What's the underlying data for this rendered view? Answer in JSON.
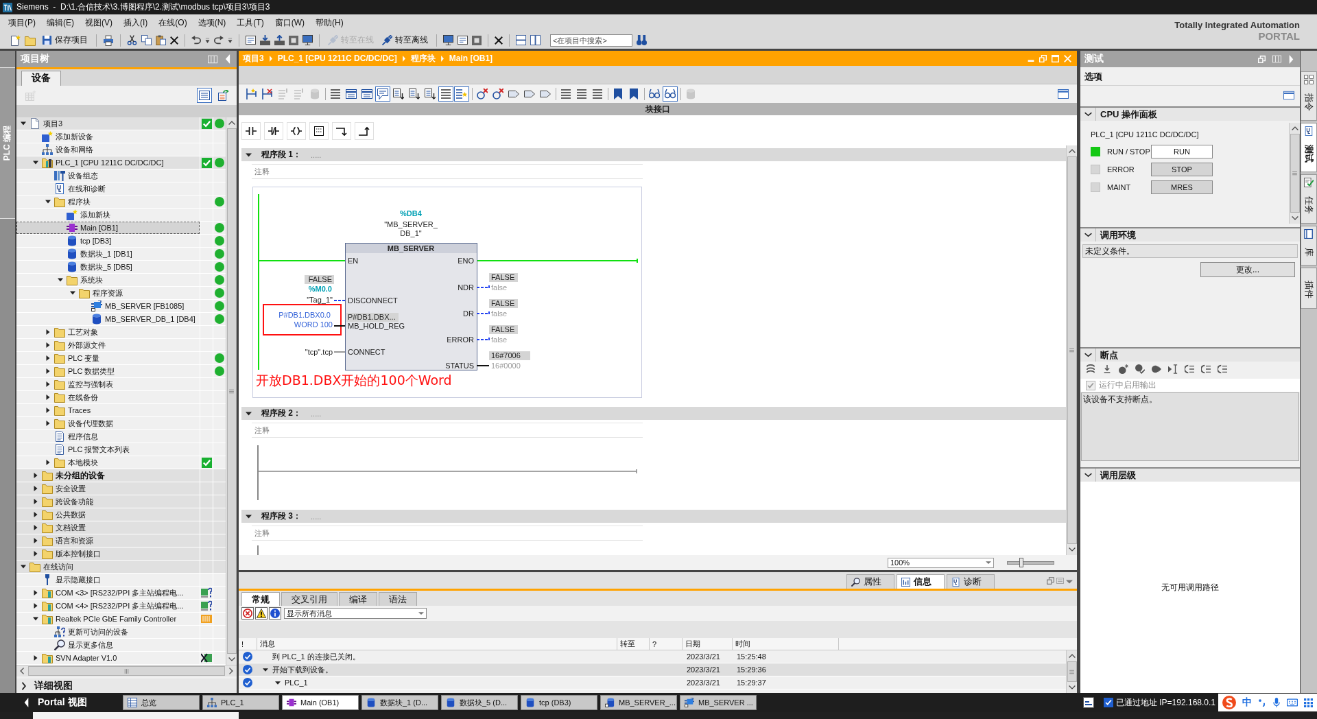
{
  "window": {
    "title": "Siemens  -  D:\\1.合信技术\\3.博图程序\\2.测试\\modbus tcp\\项目3\\项目3"
  },
  "menu": [
    "项目(P)",
    "编辑(E)",
    "视图(V)",
    "插入(I)",
    "在线(O)",
    "选项(N)",
    "工具(T)",
    "窗口(W)",
    "帮助(H)"
  ],
  "branding": {
    "line_1": "Totally Integrated Automation",
    "line_2": "PORTAL"
  },
  "toolbar": {
    "save": {
      "label": "保存项目"
    },
    "go_online": {
      "label": "转至在线",
      "disabled": true
    },
    "go_offline": {
      "label": "转至离线",
      "disabled": false
    },
    "search": {
      "placeholder": "<在项目中搜索>"
    }
  },
  "left_tabs": [
    {
      "label": "PLC 编程",
      "selected": true
    }
  ],
  "project_tree": {
    "title": "项目树",
    "tabs": [
      {
        "label": "设备",
        "selected": true
      }
    ],
    "toolbar": [
      {
        "disabled": true,
        "pressed": false
      },
      {
        "disabled": false,
        "pressed": true
      },
      {
        "disabled": false,
        "pressed": false
      }
    ],
    "items": [
      {
        "label": "项目3",
        "kind": "project",
        "expanded": true,
        "selected": false,
        "check": true,
        "dot": true,
        "children": [
          {
            "label": "添加新设备",
            "kind": "add",
            "selected": false,
            "check": false,
            "dot": false
          },
          {
            "label": "设备和网络",
            "kind": "network",
            "selected": false,
            "check": false,
            "dot": false
          },
          {
            "label": "PLC_1 [CPU 1211C DC/DC/DC]",
            "kind": "plc",
            "expanded": true,
            "selected": false,
            "check": true,
            "dot": true,
            "children": [
              {
                "label": "设备组态",
                "kind": "config",
                "selected": false,
                "check": false,
                "dot": false
              },
              {
                "label": "在线和诊断",
                "kind": "diag",
                "selected": false,
                "check": false,
                "dot": false
              },
              {
                "label": "程序块",
                "kind": "folder",
                "expanded": true,
                "selected": false,
                "check": false,
                "dot": true,
                "children": [
                  {
                    "label": "添加新块",
                    "kind": "add",
                    "selected": false,
                    "check": false,
                    "dot": false
                  },
                  {
                    "label": "Main [OB1]",
                    "kind": "ob",
                    "selected": true,
                    "check": false,
                    "dot": true
                  },
                  {
                    "label": "tcp [DB3]",
                    "kind": "db",
                    "selected": false,
                    "check": false,
                    "dot": true
                  },
                  {
                    "label": "数据块_1 [DB1]",
                    "kind": "db",
                    "selected": false,
                    "check": false,
                    "dot": true
                  },
                  {
                    "label": "数据块_5 [DB5]",
                    "kind": "db",
                    "selected": false,
                    "check": false,
                    "dot": true
                  },
                  {
                    "label": "系统块",
                    "kind": "folder",
                    "expanded": true,
                    "selected": false,
                    "check": false,
                    "dot": true,
                    "children": [
                      {
                        "label": "程序资源",
                        "kind": "folder",
                        "expanded": true,
                        "selected": false,
                        "check": false,
                        "dot": true,
                        "children": [
                          {
                            "label": "MB_SERVER [FB1085]",
                            "kind": "fb",
                            "selected": false,
                            "check": false,
                            "dot": true
                          },
                          {
                            "label": "MB_SERVER_DB_1 [DB4]",
                            "kind": "db",
                            "selected": false,
                            "check": false,
                            "dot": true
                          }
                        ]
                      }
                    ]
                  }
                ]
              },
              {
                "label": "工艺对象",
                "kind": "folder",
                "expanded": false,
                "selected": false,
                "check": false,
                "dot": false
              },
              {
                "label": "外部源文件",
                "kind": "folder",
                "expanded": false,
                "selected": false,
                "check": false,
                "dot": false
              },
              {
                "label": "PLC 变量",
                "kind": "folder",
                "expanded": false,
                "selected": false,
                "check": false,
                "dot": true
              },
              {
                "label": "PLC 数据类型",
                "kind": "folder",
                "expanded": false,
                "selected": false,
                "check": false,
                "dot": true
              },
              {
                "label": "监控与强制表",
                "kind": "folder",
                "expanded": false,
                "selected": false,
                "check": false,
                "dot": false
              },
              {
                "label": "在线备份",
                "kind": "folder",
                "expanded": false,
                "selected": false,
                "check": false,
                "dot": false
              },
              {
                "label": "Traces",
                "kind": "folder",
                "expanded": false,
                "selected": false,
                "check": false,
                "dot": false
              },
              {
                "label": "设备代理数据",
                "kind": "folder",
                "expanded": false,
                "selected": false,
                "check": false,
                "dot": false
              },
              {
                "label": "程序信息",
                "kind": "doc",
                "selected": false,
                "check": false,
                "dot": false
              },
              {
                "label": "PLC 报警文本列表",
                "kind": "doc",
                "selected": false,
                "check": false,
                "dot": false
              },
              {
                "label": "本地模块",
                "kind": "folder",
                "expanded": false,
                "selected": false,
                "check": true,
                "dot": false
              }
            ]
          },
          {
            "label": "未分组的设备",
            "kind": "section",
            "expanded": false,
            "selected": false,
            "check": false,
            "dot": false,
            "emphasis": true
          },
          {
            "label": "安全设置",
            "kind": "section",
            "expanded": false,
            "selected": false,
            "check": false,
            "dot": false
          },
          {
            "label": "跨设备功能",
            "kind": "section",
            "expanded": false,
            "selected": false,
            "check": false,
            "dot": false
          },
          {
            "label": "公共数据",
            "kind": "section",
            "expanded": false,
            "selected": false,
            "check": false,
            "dot": false
          },
          {
            "label": "文档设置",
            "kind": "section",
            "expanded": false,
            "selected": false,
            "check": false,
            "dot": false
          },
          {
            "label": "语言和资源",
            "kind": "section",
            "expanded": false,
            "selected": false,
            "check": false,
            "dot": false
          },
          {
            "label": "版本控制接口",
            "kind": "section",
            "expanded": false,
            "selected": false,
            "check": false,
            "dot": false
          }
        ]
      },
      {
        "label": "在线访问",
        "kind": "section",
        "expanded": true,
        "selected": false,
        "check": false,
        "dot": false,
        "children": [
          {
            "label": "显示隐藏接口",
            "kind": "wrench",
            "selected": false,
            "check": false,
            "dot": false
          },
          {
            "label": "COM <3> [RS232/PPI 多主站编程电...",
            "kind": "adapter",
            "expanded": false,
            "selected": false,
            "check": false,
            "dot": false,
            "adapter": {
              "kind": "unknown"
            }
          },
          {
            "label": "COM <4> [RS232/PPI 多主站编程电...",
            "kind": "adapter",
            "expanded": false,
            "selected": false,
            "check": false,
            "dot": false,
            "adapter": {
              "kind": "unknown"
            }
          },
          {
            "label": "Realtek PCIe GbE Family Controller",
            "kind": "adapter",
            "expanded": true,
            "selected": false,
            "check": false,
            "dot": false,
            "adapter": {
              "kind": "active"
            },
            "children": [
              {
                "label": "更新可访问的设备",
                "kind": "refresh",
                "selected": false,
                "check": false,
                "dot": false
              },
              {
                "label": "显示更多信息",
                "kind": "info",
                "selected": false,
                "check": false,
                "dot": false
              }
            ]
          },
          {
            "label": "SVN Adapter V1.0",
            "kind": "adapter",
            "expanded": false,
            "selected": false,
            "check": false,
            "dot": false,
            "adapter": {
              "kind": "off"
            }
          }
        ]
      }
    ],
    "detail_view": {
      "label": "详细视图",
      "expanded": false
    }
  },
  "editor": {
    "breadcrumb": [
      "项目3",
      "PLC_1 [CPU 1211C DC/DC/DC]",
      "程序块",
      "Main [OB1]"
    ],
    "toolbar_buttons": [
      {
        "pressed": false,
        "disabled": false
      },
      {
        "pressed": false,
        "disabled": false
      },
      {
        "pressed": false,
        "disabled": true
      },
      {
        "pressed": false,
        "disabled": true
      },
      {
        "pressed": false,
        "disabled": true
      },
      {
        "pressed": false,
        "disabled": false
      },
      {
        "pressed": false,
        "disabled": false
      },
      {
        "pressed": false,
        "disabled": false
      },
      {
        "pressed": true,
        "disabled": false
      },
      {
        "pressed": false,
        "disabled": false
      },
      {
        "pressed": false,
        "disabled": false
      },
      {
        "pressed": false,
        "disabled": false
      },
      {
        "pressed": true,
        "disabled": false
      },
      {
        "pressed": true,
        "disabled": false
      },
      {
        "pressed": false,
        "disabled": false
      },
      {
        "pressed": false,
        "disabled": false
      },
      {
        "pressed": false,
        "disabled": false
      },
      {
        "pressed": false,
        "disabled": false
      },
      {
        "pressed": false,
        "disabled": false
      },
      {
        "pressed": false,
        "disabled": false
      },
      {
        "pressed": false,
        "disabled": false
      },
      {
        "pressed": false,
        "disabled": false
      },
      {
        "pressed": false,
        "disabled": false
      },
      {
        "pressed": false,
        "disabled": false
      },
      {
        "pressed": false,
        "disabled": false
      },
      {
        "pressed": true,
        "disabled": false
      },
      {
        "pressed": false,
        "disabled": true
      }
    ],
    "interface_bar": {
      "label": "块接口"
    },
    "networks": [
      {
        "label": "程序段 1：",
        "kind": "box",
        "expanded": true,
        "title_field": {
          "placeholder": "....."
        },
        "comment_field": {
          "placeholder": "注释"
        },
        "block": {
          "instance_address": "%DB4",
          "instance_name_lines": [
            "\"MB_SERVER_",
            "DB_1\""
          ],
          "type": "MB_SERVER",
          "enable_in": "EN",
          "enable_out": "ENO",
          "inputs": [
            {
              "pin": "DISCONNECT",
              "kind": "bool",
              "monitor": "FALSE",
              "address": "%M0.0",
              "operand": "\"Tag_1\""
            },
            {
              "pin": "MB_HOLD_REG",
              "kind": "pointer",
              "monitor": "P#DB1.DBX...",
              "operand_lines": [
                "P#DB1.DBX0.0",
                "WORD 100"
              ],
              "highlighted": true
            },
            {
              "pin": "CONNECT",
              "kind": "variant",
              "operand": "\"tcp\".tcp"
            }
          ],
          "outputs": [
            {
              "pin": "NDR",
              "kind": "bool",
              "monitor": "FALSE",
              "operand": "false"
            },
            {
              "pin": "DR",
              "kind": "bool",
              "monitor": "FALSE",
              "operand": "false"
            },
            {
              "pin": "ERROR",
              "kind": "bool",
              "monitor": "FALSE",
              "operand": "false"
            },
            {
              "pin": "STATUS",
              "kind": "word",
              "monitor": "16#7006",
              "operand": "16#0000"
            }
          ]
        },
        "annotation": "开放DB1.DBX开始的100个Word"
      },
      {
        "label": "程序段 2：",
        "kind": "empty-rung",
        "expanded": true,
        "title_field": {
          "placeholder": "....."
        },
        "comment_field": {
          "placeholder": "注释"
        }
      },
      {
        "label": "程序段 3：",
        "kind": "rail",
        "expanded": true,
        "title_field": {
          "placeholder": "....."
        },
        "comment_field": {
          "placeholder": "注释"
        }
      }
    ],
    "zoom": {
      "value": "100%"
    },
    "zoom_slider": {
      "level": 0.3
    }
  },
  "inspector": {
    "tabs": [
      {
        "label": "属性",
        "selected": false
      },
      {
        "label": "信息",
        "selected": true
      },
      {
        "label": "诊断",
        "selected": false
      }
    ],
    "subtabs": [
      {
        "label": "常规",
        "selected": true
      },
      {
        "label": "交叉引用",
        "selected": false
      },
      {
        "label": "编译",
        "selected": false
      },
      {
        "label": "语法",
        "selected": false
      }
    ],
    "filters": [
      {
        "kind": "error",
        "on": true
      },
      {
        "kind": "warning",
        "on": true
      },
      {
        "kind": "info",
        "on": true
      }
    ],
    "filter_select": {
      "value": "显示所有消息"
    },
    "columns": [
      "!",
      "消息",
      "转至",
      "?",
      "日期",
      "时间"
    ],
    "messages": [
      {
        "kind": "success",
        "text": "到 PLC_1 的连接已关闭。",
        "date": "2023/3/21",
        "time": "15:25:48",
        "selected": false
      },
      {
        "kind": "success",
        "text": "开始下载到设备。",
        "date": "2023/3/21",
        "time": "15:29:36",
        "selected": true,
        "expanded": true,
        "children": [
          {
            "kind": "success",
            "text": "PLC_1",
            "date": "2023/3/21",
            "time": "15:29:37",
            "selected": false,
            "expanded": true
          }
        ]
      }
    ]
  },
  "test_panel": {
    "title": "测试",
    "options_label": "选项",
    "sections": [
      {
        "kind": "cpu",
        "title": "CPU 操作面板",
        "expanded": true,
        "device": "PLC_1 [CPU 1211C DC/DC/DC]",
        "rows": [
          {
            "label": "RUN / STOP",
            "lit": true,
            "button": "RUN",
            "active": true
          },
          {
            "label": "ERROR",
            "lit": false,
            "button": "STOP",
            "active": false
          },
          {
            "label": "MAINT",
            "lit": false,
            "button": "MRES",
            "active": false
          }
        ]
      },
      {
        "kind": "environment",
        "title": "调用环境",
        "expanded": true,
        "value": "未定义条件。",
        "button": "更改..."
      },
      {
        "kind": "breakpoints",
        "title": "断点",
        "expanded": true,
        "checkbox": {
          "label": "运行中启用输出",
          "checked": true,
          "disabled": true
        },
        "message": "该设备不支持断点。"
      },
      {
        "kind": "hierarchy",
        "title": "调用层级",
        "expanded": true,
        "message": "无可用调用路径"
      }
    ]
  },
  "side_tabs": [
    {
      "label": "指令",
      "selected": false
    },
    {
      "label": "测试",
      "selected": true
    },
    {
      "label": "任务",
      "selected": false
    },
    {
      "label": "库",
      "selected": false
    },
    {
      "label": "插件",
      "selected": false
    }
  ],
  "portal_bar": {
    "portal_label": "Portal 视图",
    "tabs": [
      {
        "label": "总览",
        "kind": "overview",
        "selected": false
      },
      {
        "label": "PLC_1",
        "kind": "device",
        "selected": false
      },
      {
        "label": "Main (OB1)",
        "kind": "ob",
        "selected": true
      },
      {
        "label": "数据块_1 (D...",
        "kind": "db",
        "selected": false
      },
      {
        "label": "数据块_5 (D...",
        "kind": "db",
        "selected": false
      },
      {
        "label": "tcp (DB3)",
        "kind": "db",
        "selected": false
      },
      {
        "label": "MB_SERVER_...",
        "kind": "instance",
        "selected": false
      },
      {
        "label": "MB_SERVER ...",
        "kind": "fb",
        "selected": false
      }
    ],
    "status": "已通过地址 IP=192.168.0.1",
    "ime_label": "中"
  }
}
